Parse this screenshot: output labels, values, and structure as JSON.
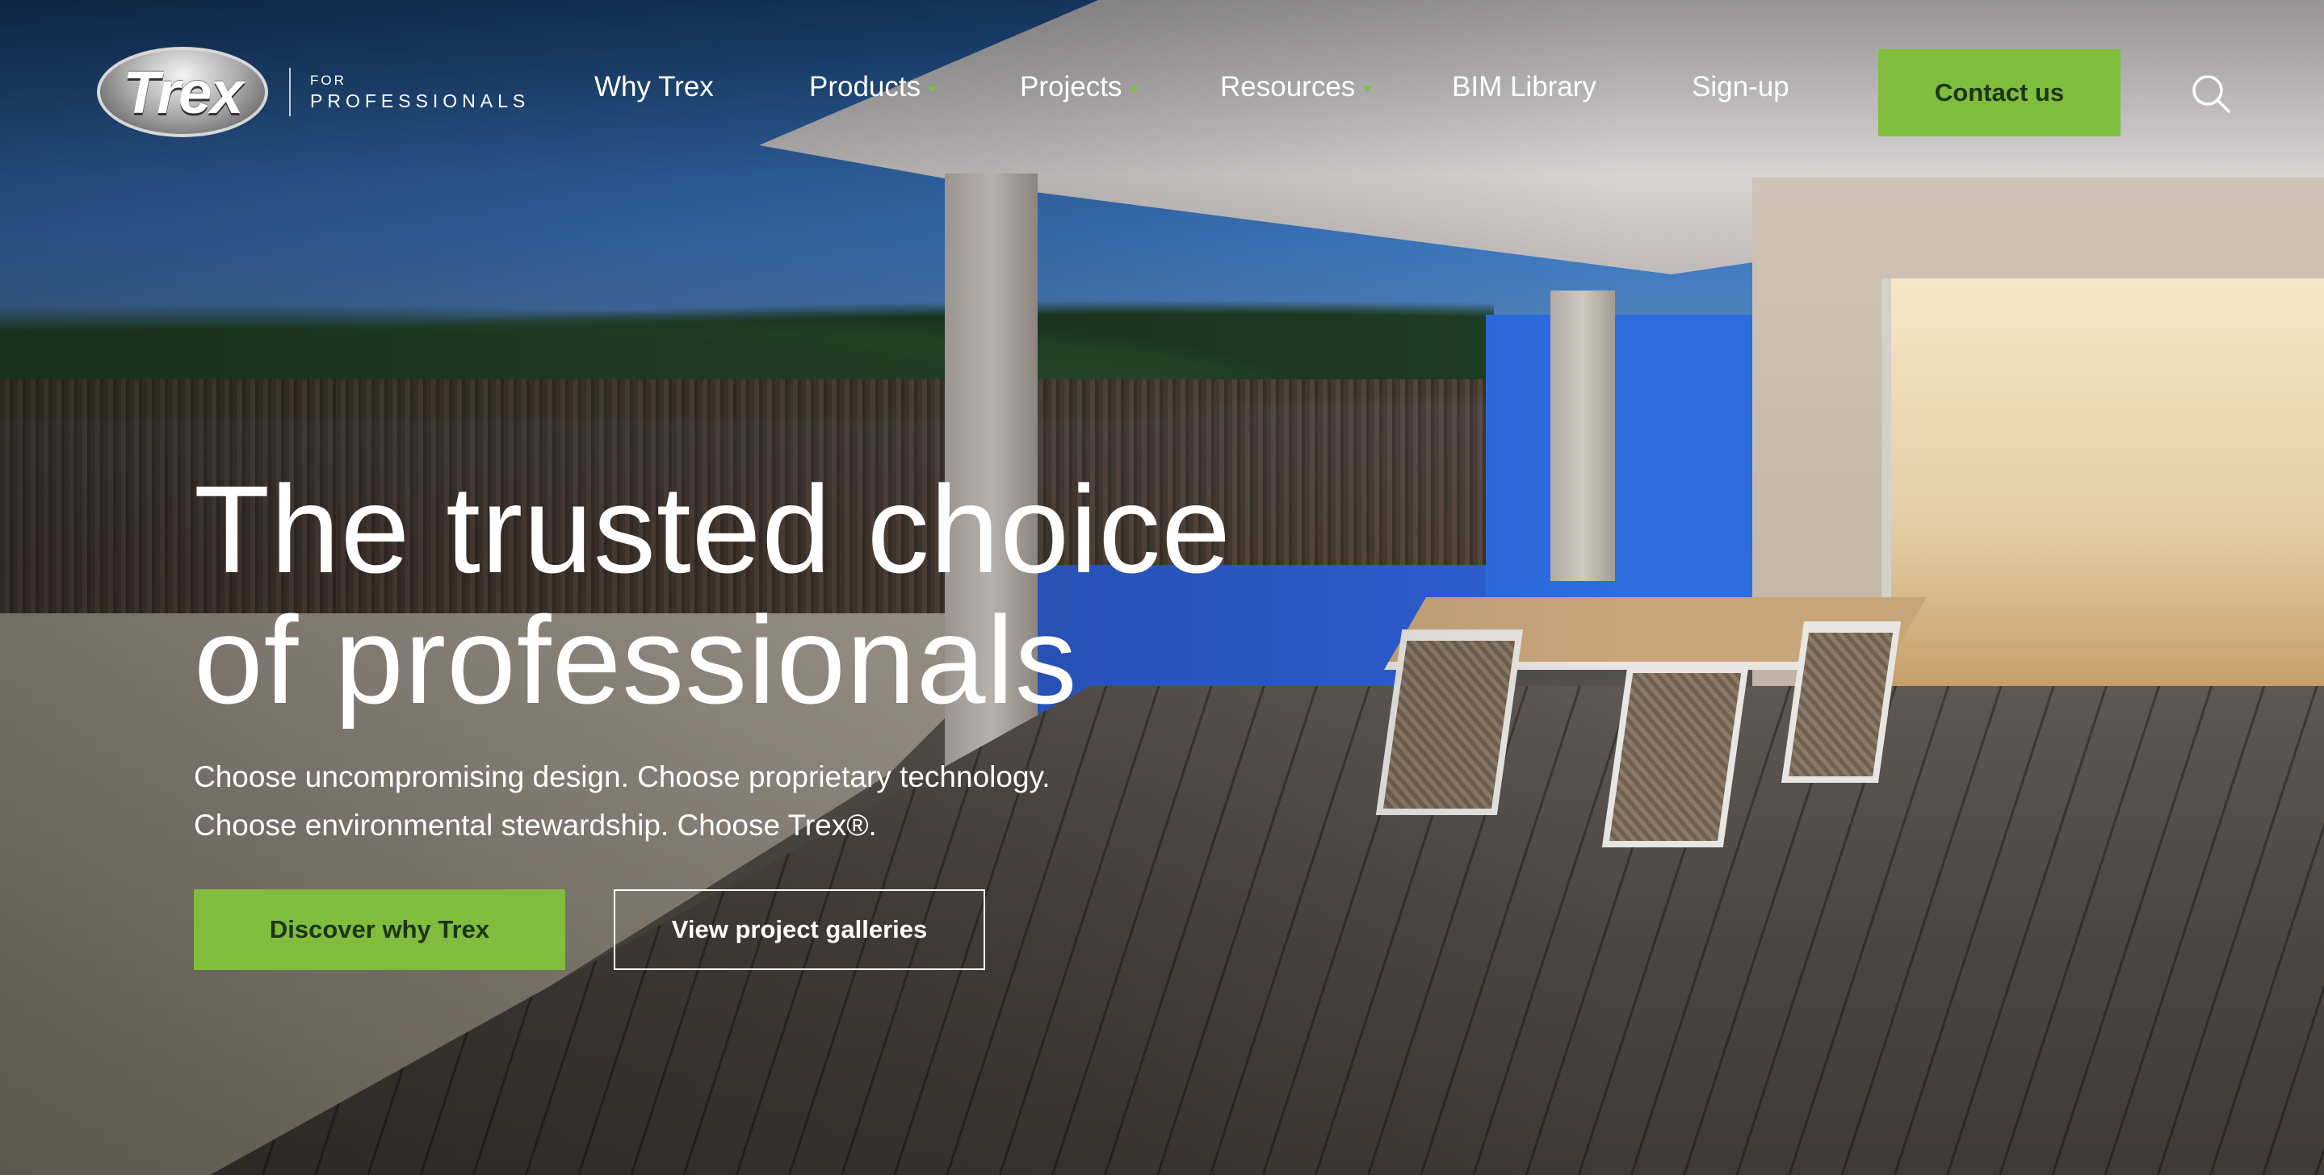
{
  "brand": {
    "logo_text": "Trex",
    "for_label": "FOR",
    "professionals_label": "PROFESSIONALS"
  },
  "nav": {
    "items": [
      {
        "label": "Why Trex",
        "has_dropdown": false
      },
      {
        "label": "Products",
        "has_dropdown": true
      },
      {
        "label": "Projects",
        "has_dropdown": true
      },
      {
        "label": "Resources",
        "has_dropdown": true
      },
      {
        "label": "BIM Library",
        "has_dropdown": false
      },
      {
        "label": "Sign-up",
        "has_dropdown": false
      }
    ],
    "contact_label": "Contact us",
    "search_icon": "search-icon"
  },
  "hero": {
    "headline_line1": "The trusted choice",
    "headline_line2": "of professionals",
    "subtext_line1": "Choose uncompromising design. Choose proprietary technology.",
    "subtext_line2": "Choose environmental stewardship. Choose Trex®.",
    "primary_cta": "Discover why Trex",
    "secondary_cta": "View project galleries"
  },
  "colors": {
    "accent_green": "#80bd3d",
    "button_text_dark": "#1d3417",
    "text_white": "#ffffff"
  }
}
